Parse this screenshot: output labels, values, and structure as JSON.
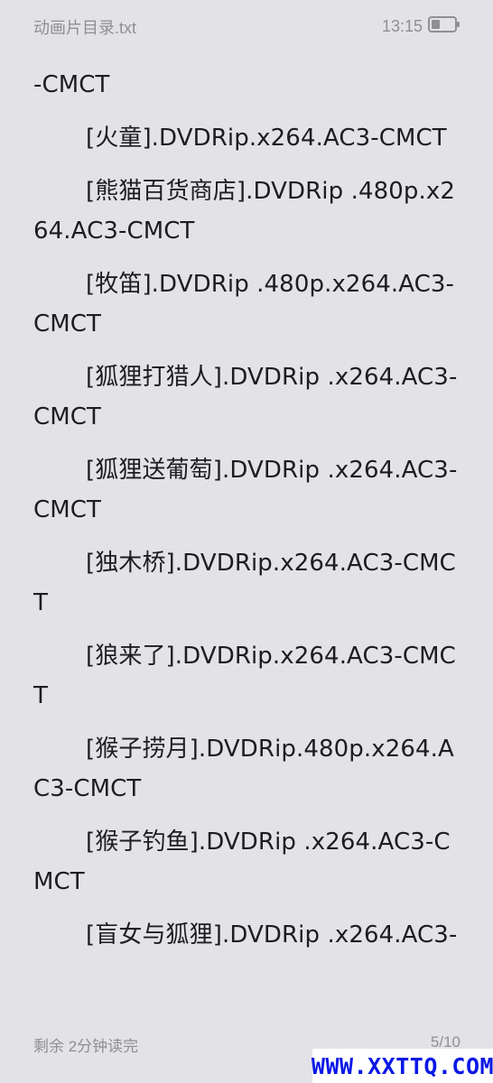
{
  "status_bar": {
    "file_title": "动画片目录.txt",
    "time": "13:15",
    "battery_icon": "battery-icon"
  },
  "content": {
    "paragraphs": [
      {
        "text": "-CMCT",
        "indent": false
      },
      {
        "text": "[火童].DVDRip.x264.AC3-CMCT",
        "indent": true
      },
      {
        "text": "[熊猫百货商店].DVDRip .480p.x264.AC3-CMCT",
        "indent": true
      },
      {
        "text": "[牧笛].DVDRip .480p.x264.AC3-CMCT",
        "indent": true
      },
      {
        "text": "[狐狸打猎人].DVDRip .x264.AC3-CMCT",
        "indent": true
      },
      {
        "text": "[狐狸送葡萄].DVDRip .x264.AC3-CMCT",
        "indent": true
      },
      {
        "text": "[独木桥].DVDRip.x264.AC3-CMCT",
        "indent": true
      },
      {
        "text": "[狼来了].DVDRip.x264.AC3-CMCT",
        "indent": true
      },
      {
        "text": "[猴子捞月].DVDRip.480p.x264.AC3-CMCT",
        "indent": true
      },
      {
        "text": "[猴子钓鱼].DVDRip .x264.AC3-CMCT",
        "indent": true
      },
      {
        "text": "[盲女与狐狸].DVDRip .x264.AC3-",
        "indent": true
      }
    ]
  },
  "footer": {
    "remaining_time": "剩余 2分钟读完",
    "page_indicator": "5/10"
  },
  "watermark": {
    "text": "WWW.XXTTQ.COM",
    "color": "#0a18e6"
  },
  "colors": {
    "background": "#e3e3e7",
    "text": "#1d1d1f",
    "muted": "#8e8e93"
  }
}
